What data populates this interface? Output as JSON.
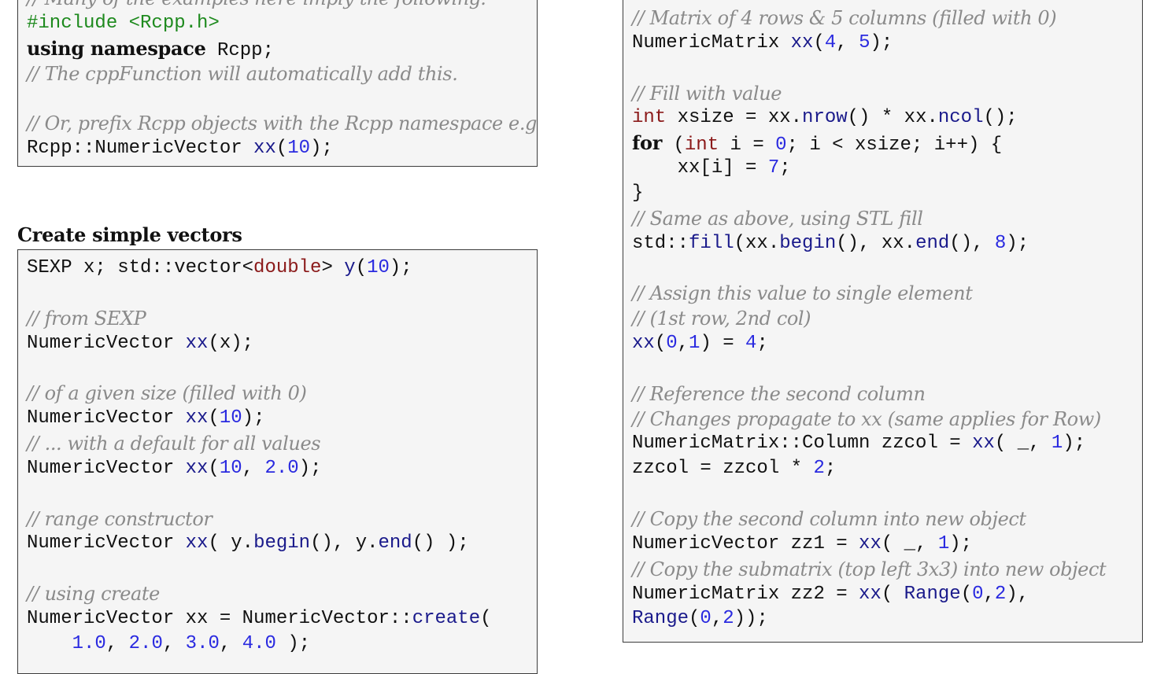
{
  "heading": "Create simple vectors",
  "box_top": [
    [
      {
        "t": "// Many of the examples here imply the following:",
        "c": "c"
      }
    ],
    [
      {
        "t": "#include <Rcpp.h>",
        "c": "pp"
      }
    ],
    [
      {
        "t": "using namespace",
        "c": "kw"
      },
      {
        "t": " Rcpp;"
      }
    ],
    [
      {
        "t": "// The cppFunction will automatically add this.",
        "c": "c"
      }
    ],
    [],
    [
      {
        "t": "// Or, prefix Rcpp objects with the Rcpp namespace e.g.:",
        "c": "c"
      }
    ],
    [
      {
        "t": "Rcpp::NumericVector "
      },
      {
        "t": "xx",
        "c": "fn"
      },
      {
        "t": "("
      },
      {
        "t": "10",
        "c": "nm"
      },
      {
        "t": ");"
      }
    ]
  ],
  "box_vectors": [
    [
      {
        "t": "SEXP x; std::vector<"
      },
      {
        "t": "double",
        "c": "tp"
      },
      {
        "t": "> "
      },
      {
        "t": "y",
        "c": "fn"
      },
      {
        "t": "("
      },
      {
        "t": "10",
        "c": "nm"
      },
      {
        "t": ");"
      }
    ],
    [],
    [
      {
        "t": "// from SEXP",
        "c": "c"
      }
    ],
    [
      {
        "t": "NumericVector "
      },
      {
        "t": "xx",
        "c": "fn"
      },
      {
        "t": "(x);"
      }
    ],
    [],
    [
      {
        "t": "// of a given size (filled with 0)",
        "c": "c"
      }
    ],
    [
      {
        "t": "NumericVector "
      },
      {
        "t": "xx",
        "c": "fn"
      },
      {
        "t": "("
      },
      {
        "t": "10",
        "c": "nm"
      },
      {
        "t": ");"
      }
    ],
    [
      {
        "t": "// ... with a default for all values",
        "c": "c"
      }
    ],
    [
      {
        "t": "NumericVector "
      },
      {
        "t": "xx",
        "c": "fn"
      },
      {
        "t": "("
      },
      {
        "t": "10",
        "c": "nm"
      },
      {
        "t": ", "
      },
      {
        "t": "2.0",
        "c": "nm"
      },
      {
        "t": ");"
      }
    ],
    [],
    [
      {
        "t": "// range constructor",
        "c": "c"
      }
    ],
    [
      {
        "t": "NumericVector "
      },
      {
        "t": "xx",
        "c": "fn"
      },
      {
        "t": "( y."
      },
      {
        "t": "begin",
        "c": "fn"
      },
      {
        "t": "(), y."
      },
      {
        "t": "end",
        "c": "fn"
      },
      {
        "t": "() );"
      }
    ],
    [],
    [
      {
        "t": "// using create",
        "c": "c"
      }
    ],
    [
      {
        "t": "NumericVector xx = NumericVector::"
      },
      {
        "t": "create",
        "c": "fn"
      },
      {
        "t": "("
      }
    ],
    [
      {
        "t": "    "
      },
      {
        "t": "1.0",
        "c": "nm"
      },
      {
        "t": ", "
      },
      {
        "t": "2.0",
        "c": "nm"
      },
      {
        "t": ", "
      },
      {
        "t": "3.0",
        "c": "nm"
      },
      {
        "t": ", "
      },
      {
        "t": "4.0",
        "c": "nm"
      },
      {
        "t": " );"
      }
    ]
  ],
  "box_matrix": [
    [
      {
        "t": "// Matrix of 4 rows & 5 columns (filled with 0)",
        "c": "c"
      }
    ],
    [
      {
        "t": "NumericMatrix "
      },
      {
        "t": "xx",
        "c": "fn"
      },
      {
        "t": "("
      },
      {
        "t": "4",
        "c": "nm"
      },
      {
        "t": ", "
      },
      {
        "t": "5",
        "c": "nm"
      },
      {
        "t": ");"
      }
    ],
    [],
    [
      {
        "t": "// Fill with value",
        "c": "c"
      }
    ],
    [
      {
        "t": "int",
        "c": "tp"
      },
      {
        "t": " xsize = xx."
      },
      {
        "t": "nrow",
        "c": "fn"
      },
      {
        "t": "() * xx."
      },
      {
        "t": "ncol",
        "c": "fn"
      },
      {
        "t": "();"
      }
    ],
    [
      {
        "t": "for",
        "c": "kw"
      },
      {
        "t": " ("
      },
      {
        "t": "int",
        "c": "tp"
      },
      {
        "t": " i = "
      },
      {
        "t": "0",
        "c": "nm"
      },
      {
        "t": "; i < xsize; i++) {"
      }
    ],
    [
      {
        "t": "    xx[i] = "
      },
      {
        "t": "7",
        "c": "nm"
      },
      {
        "t": ";"
      }
    ],
    [
      {
        "t": "}"
      }
    ],
    [
      {
        "t": "// Same as above, using STL fill",
        "c": "c"
      }
    ],
    [
      {
        "t": "std::"
      },
      {
        "t": "fill",
        "c": "fn"
      },
      {
        "t": "(xx."
      },
      {
        "t": "begin",
        "c": "fn"
      },
      {
        "t": "(), xx."
      },
      {
        "t": "end",
        "c": "fn"
      },
      {
        "t": "(), "
      },
      {
        "t": "8",
        "c": "nm"
      },
      {
        "t": ");"
      }
    ],
    [],
    [
      {
        "t": "// Assign this value to single element",
        "c": "c"
      }
    ],
    [
      {
        "t": "// (1st row, 2nd col)",
        "c": "c"
      }
    ],
    [
      {
        "t": "xx",
        "c": "fn"
      },
      {
        "t": "("
      },
      {
        "t": "0",
        "c": "nm"
      },
      {
        "t": ","
      },
      {
        "t": "1",
        "c": "nm"
      },
      {
        "t": ") = "
      },
      {
        "t": "4",
        "c": "nm"
      },
      {
        "t": ";"
      }
    ],
    [],
    [
      {
        "t": "// Reference the second column",
        "c": "c"
      }
    ],
    [
      {
        "t": "// Changes propagate to xx (same applies for Row)",
        "c": "c"
      }
    ],
    [
      {
        "t": "NumericMatrix::Column zzcol = "
      },
      {
        "t": "xx",
        "c": "fn"
      },
      {
        "t": "( _, "
      },
      {
        "t": "1",
        "c": "nm"
      },
      {
        "t": ");"
      }
    ],
    [
      {
        "t": "zzcol = zzcol * "
      },
      {
        "t": "2",
        "c": "nm"
      },
      {
        "t": ";"
      }
    ],
    [],
    [
      {
        "t": "// Copy the second column into new object",
        "c": "c"
      }
    ],
    [
      {
        "t": "NumericVector zz1 = "
      },
      {
        "t": "xx",
        "c": "fn"
      },
      {
        "t": "( _, "
      },
      {
        "t": "1",
        "c": "nm"
      },
      {
        "t": ");"
      }
    ],
    [
      {
        "t": "// Copy the submatrix (top left 3x3) into new object",
        "c": "c"
      }
    ],
    [
      {
        "t": "NumericMatrix zz2 = "
      },
      {
        "t": "xx",
        "c": "fn"
      },
      {
        "t": "( "
      },
      {
        "t": "Range",
        "c": "fn"
      },
      {
        "t": "("
      },
      {
        "t": "0",
        "c": "nm"
      },
      {
        "t": ","
      },
      {
        "t": "2",
        "c": "nm"
      },
      {
        "t": "),"
      }
    ],
    [
      {
        "t": "Range",
        "c": "fn"
      },
      {
        "t": "("
      },
      {
        "t": "0",
        "c": "nm"
      },
      {
        "t": ","
      },
      {
        "t": "2",
        "c": "nm"
      },
      {
        "t": "));"
      }
    ]
  ]
}
